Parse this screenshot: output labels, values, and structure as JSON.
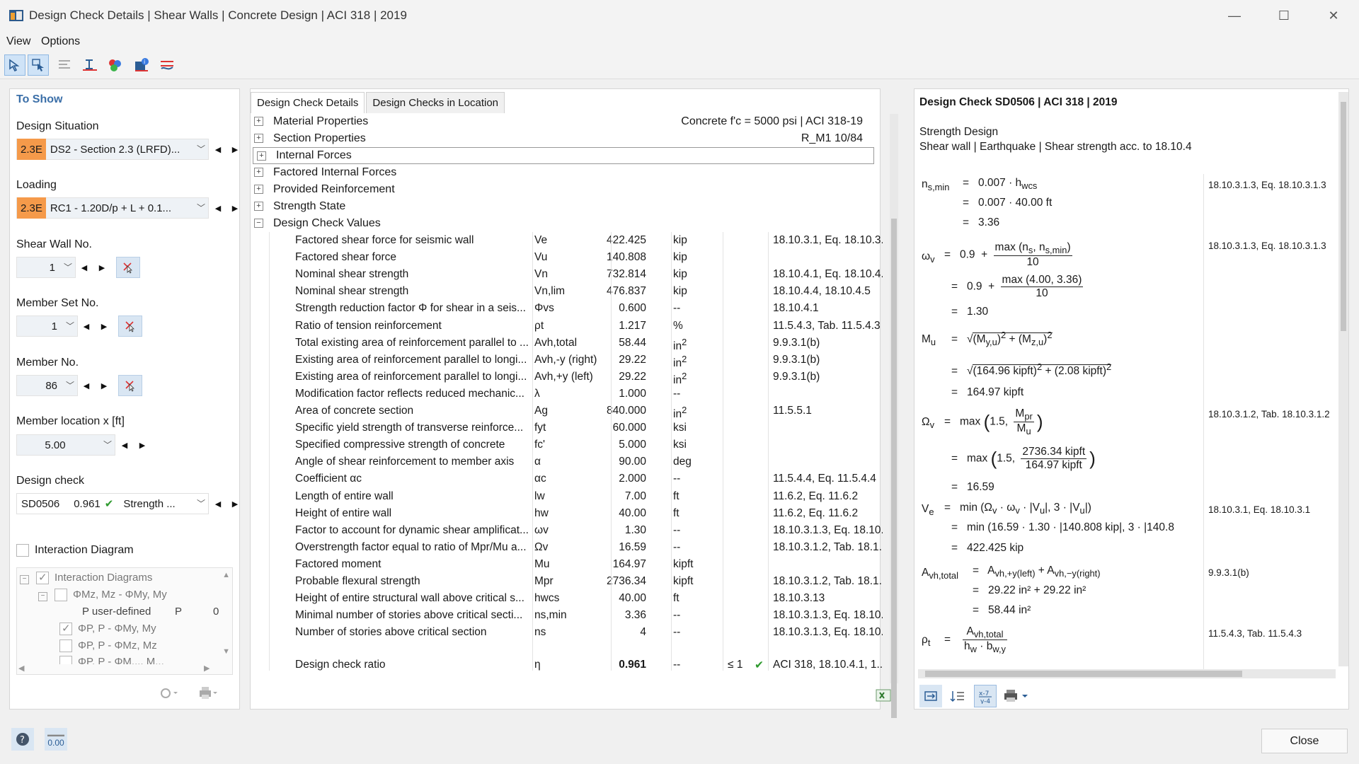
{
  "window": {
    "title": "Design Check Details | Shear Walls | Concrete Design | ACI 318 | 2019",
    "close_label": "Close"
  },
  "menu": [
    "View",
    "Options"
  ],
  "left": {
    "title": "To Show",
    "design_situation": {
      "label": "Design Situation",
      "badge": "2.3E",
      "value": "DS2 - Section 2.3 (LRFD)..."
    },
    "loading": {
      "label": "Loading",
      "badge": "2.3E",
      "value": "RC1 - 1.20D/p + L + 0.1..."
    },
    "shear_wall": {
      "label": "Shear Wall No.",
      "value": "1"
    },
    "member_set": {
      "label": "Member Set No.",
      "value": "1"
    },
    "member": {
      "label": "Member No.",
      "value": "86"
    },
    "location": {
      "label": "Member location x [ft]",
      "value": "5.00"
    },
    "design_check": {
      "label": "Design check",
      "id": "SD0506",
      "ratio": "0.961",
      "type": "Strength ..."
    },
    "interaction": {
      "label": "Interaction Diagram",
      "tree": [
        "Interaction Diagrams",
        "ΦMz, Mz - ΦMy, My",
        "P user-defined",
        "P",
        "0",
        "ΦP, P - ΦMy, My",
        "ΦP, P - ΦMz, Mz",
        "ΦP, P - ΦM..., M..."
      ]
    }
  },
  "middle": {
    "tabs": [
      "Design Check Details",
      "Design Checks in Location"
    ],
    "groups": [
      {
        "label": "Material Properties",
        "right": "Concrete f'c = 5000 psi | ACI 318-19",
        "sign": "+"
      },
      {
        "label": "Section Properties",
        "right": "R_M1 10/84",
        "sign": "+"
      },
      {
        "label": "Internal Forces",
        "right": "",
        "sign": "+"
      },
      {
        "label": "Factored Internal Forces",
        "right": "",
        "sign": "+"
      },
      {
        "label": "Provided Reinforcement",
        "right": "",
        "sign": "+"
      },
      {
        "label": "Strength State",
        "right": "",
        "sign": "+"
      },
      {
        "label": "Design Check Values",
        "right": "",
        "sign": "−"
      }
    ],
    "rows": [
      {
        "desc": "Factored shear force for seismic wall",
        "sym": "Ve",
        "val": "422.425",
        "unit": "kip",
        "ref": "18.10.3.1, Eq. 18.10.3..."
      },
      {
        "desc": "Factored shear force",
        "sym": "Vu",
        "val": "140.808",
        "unit": "kip",
        "ref": ""
      },
      {
        "desc": "Nominal shear strength",
        "sym": "Vn",
        "val": "732.814",
        "unit": "kip",
        "ref": "18.10.4.1, Eq. 18.10.4..."
      },
      {
        "desc": "Nominal shear strength",
        "sym": "Vn,lim",
        "val": "476.837",
        "unit": "kip",
        "ref": "18.10.4.4, 18.10.4.5"
      },
      {
        "desc": "Strength reduction factor Φ for shear in a seis...",
        "sym": "Φvs",
        "val": "0.600",
        "unit": "--",
        "ref": "18.10.4.1"
      },
      {
        "desc": "Ratio of tension reinforcement",
        "sym": "ρt",
        "val": "1.217",
        "unit": "%",
        "ref": "11.5.4.3, Tab. 11.5.4.3"
      },
      {
        "desc": "Total existing area of reinforcement parallel to ...",
        "sym": "Avh,total",
        "val": "58.44",
        "unit": "in2",
        "ref": "9.9.3.1(b)"
      },
      {
        "desc": "Existing area of reinforcement parallel to longi...",
        "sym": "Avh,-y (right)",
        "val": "29.22",
        "unit": "in2",
        "ref": "9.9.3.1(b)"
      },
      {
        "desc": "Existing area of reinforcement parallel to longi...",
        "sym": "Avh,+y (left)",
        "val": "29.22",
        "unit": "in2",
        "ref": "9.9.3.1(b)"
      },
      {
        "desc": "Modification factor reflects reduced mechanic...",
        "sym": "λ",
        "val": "1.000",
        "unit": "--",
        "ref": ""
      },
      {
        "desc": "Area of concrete section",
        "sym": "Ag",
        "val": "840.000",
        "unit": "in2",
        "ref": "11.5.5.1"
      },
      {
        "desc": "Specific yield strength of transverse reinforce...",
        "sym": "fyt",
        "val": "60.000",
        "unit": "ksi",
        "ref": ""
      },
      {
        "desc": "Specified compressive strength of concrete",
        "sym": "fc'",
        "val": "5.000",
        "unit": "ksi",
        "ref": ""
      },
      {
        "desc": "Angle of shear reinforcement to member axis",
        "sym": "α",
        "val": "90.00",
        "unit": "deg",
        "ref": ""
      },
      {
        "desc": "Coefficient αc",
        "sym": "αc",
        "val": "2.000",
        "unit": "--",
        "ref": "11.5.4.4, Eq. 11.5.4.4"
      },
      {
        "desc": "Length of entire wall",
        "sym": "lw",
        "val": "7.00",
        "unit": "ft",
        "ref": "11.6.2, Eq. 11.6.2"
      },
      {
        "desc": "Height of entire wall",
        "sym": "hw",
        "val": "40.00",
        "unit": "ft",
        "ref": "11.6.2, Eq. 11.6.2"
      },
      {
        "desc": "Factor to account for dynamic shear amplificat...",
        "sym": "ωv",
        "val": "1.30",
        "unit": "--",
        "ref": "18.10.3.1.3, Eq. 18.10..."
      },
      {
        "desc": "Overstrength factor equal to ratio of Mpr/Mu a...",
        "sym": "Ωv",
        "val": "16.59",
        "unit": "--",
        "ref": "18.10.3.1.2, Tab. 18.1..."
      },
      {
        "desc": "Factored moment",
        "sym": "Mu",
        "val": "164.97",
        "unit": "kipft",
        "ref": ""
      },
      {
        "desc": "Probable flexural strength",
        "sym": "Mpr",
        "val": "2736.34",
        "unit": "kipft",
        "ref": "18.10.3.1.2, Tab. 18.1..."
      },
      {
        "desc": "Height of entire structural wall above critical s...",
        "sym": "hwcs",
        "val": "40.00",
        "unit": "ft",
        "ref": "18.10.3.13"
      },
      {
        "desc": "Minimal number of stories above critical secti...",
        "sym": "ns,min",
        "val": "3.36",
        "unit": "--",
        "ref": "18.10.3.1.3, Eq. 18.10..."
      },
      {
        "desc": "Number of stories above critical section",
        "sym": "ns",
        "val": "4",
        "unit": "--",
        "ref": "18.10.3.1.3, Eq. 18.10..."
      }
    ],
    "ratio_row": {
      "desc": "Design check ratio",
      "sym": "η",
      "val": "0.961",
      "unit": "--",
      "limit": "≤ 1",
      "ref": "ACI 318, 18.10.4.1, 1..."
    }
  },
  "right": {
    "title": "Design Check SD0506 | ACI 318 | 2019",
    "line1": "Strength Design",
    "line2": "Shear wall | Earthquake | Shear strength acc. to 18.10.4",
    "refs": {
      "ns": "18.10.3.1.3, Eq. 18.10.3.1.3",
      "wv": "18.10.3.1.3, Eq. 18.10.3.1.3",
      "Ov": "18.10.3.1.2, Tab. 18.10.3.1.2",
      "Ve": "18.10.3.1, Eq. 18.10.3.1",
      "Avh": "9.9.3.1(b)",
      "rho": "11.5.4.3, Tab. 11.5.4.3"
    },
    "eq": {
      "ns1": "0.007 · hwcs",
      "ns2": "0.007 · 40.00 ft",
      "ns3": "3.36",
      "wv_num1": "max (ns, ns,min)",
      "wv_num2": "max (4.00, 3.36)",
      "wv_den": "10",
      "wv_const": "0.9",
      "wv3": "1.30",
      "mu3": "164.97 kipft",
      "ov_num": "Mpr",
      "ov_den": "Mu",
      "ov_num2": "2736.34 kipft",
      "ov_den2": "164.97 kipft",
      "ov3": "16.59",
      "ve1": "min (Ωv · ωv · |Vu|, 3 · |Vu|)",
      "ve2": "min (16.59 · 1.30 · |140.808 kip|, 3 · |140.8",
      "ve3": "422.425 kip",
      "avh1": "Avh,+y(left) + Avh,−y(right)",
      "avh2": "29.22 in² + 29.22 in²",
      "avh3": "58.44 in²",
      "rho_num": "Avh,total",
      "rho_den": "hw · bw,y"
    }
  },
  "status": {
    "units": "0.00"
  }
}
